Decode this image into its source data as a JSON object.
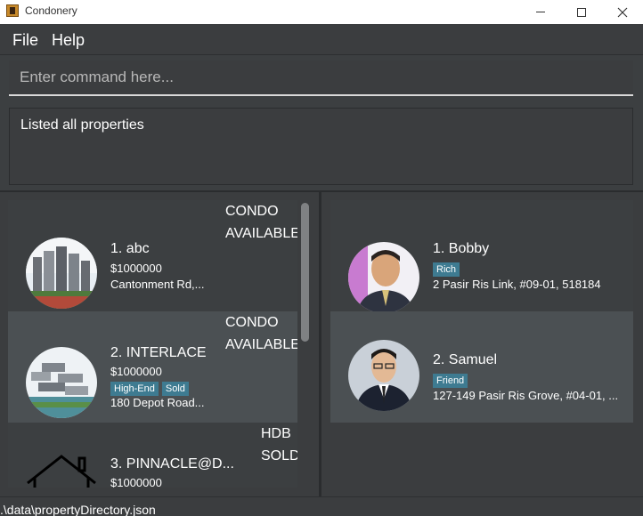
{
  "window": {
    "title": "Condonery"
  },
  "menu": {
    "file": "File",
    "help": "Help"
  },
  "command": {
    "placeholder": "Enter command here..."
  },
  "result": {
    "text": "Listed all properties"
  },
  "properties": [
    {
      "index_name": "1.  abc",
      "price": "$1000000",
      "address": "Cantonment Rd,...",
      "type": "CONDO",
      "status": "AVAILABLE",
      "tags": []
    },
    {
      "index_name": "2.  INTERLACE",
      "price": "$1000000",
      "address": "180 Depot Road...",
      "type": "CONDO",
      "status": "AVAILABLE",
      "tags": [
        "High-End",
        "Sold"
      ]
    },
    {
      "index_name": "3.  PINNACLE@D...",
      "price": "$1000000",
      "address": "",
      "type": "HDB",
      "status": "SOLD",
      "tags": []
    }
  ],
  "clients": [
    {
      "index_name": "1.  Bobby",
      "tags": [
        "Rich"
      ],
      "address": "2 Pasir Ris Link, #09-01, 518184"
    },
    {
      "index_name": "2.  Samuel",
      "tags": [
        "Friend"
      ],
      "address": "127-149 Pasir Ris Grove, #04-01, ..."
    }
  ],
  "statusbar": {
    "path": ".\\data\\propertyDirectory.json"
  },
  "colors": {
    "tag": "#3e7b91",
    "panel": "#3b3d3f",
    "selected_row": "#4b5053"
  }
}
